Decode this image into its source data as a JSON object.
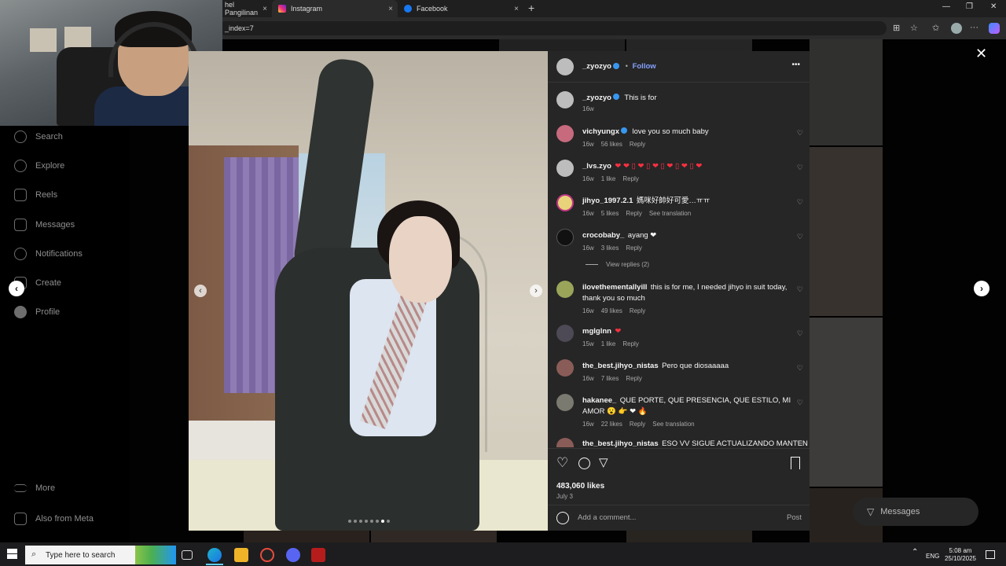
{
  "browser": {
    "tabs": [
      {
        "title": "hel Pangilinan"
      },
      {
        "title": "Instagram"
      },
      {
        "title": "Facebook"
      }
    ],
    "url": "_index=7",
    "new_tab": "+",
    "close": "×"
  },
  "sidebar": {
    "items": [
      {
        "label": "Search"
      },
      {
        "label": "Explore"
      },
      {
        "label": "Reels"
      },
      {
        "label": "Messages"
      },
      {
        "label": "Notifications"
      },
      {
        "label": "Create"
      },
      {
        "label": "Profile"
      }
    ],
    "more": "More",
    "also_from_meta": "Also from Meta"
  },
  "post": {
    "username": "_zyozyo",
    "follow": "Follow",
    "more": "•••",
    "caption": {
      "username": "_zyozyo",
      "text": "This is for",
      "time": "16w"
    },
    "comments": [
      {
        "username": "vichyungx",
        "verified": true,
        "text": "love you so much baby",
        "time": "16w",
        "likes": "56 likes",
        "reply": "Reply"
      },
      {
        "username": "_lvs.zyo",
        "text": "❤ ❤ ▯ ❤ ▯ ❤ ▯ ❤ ▯ ❤ ▯ ❤",
        "time": "16w",
        "likes": "1 like",
        "reply": "Reply"
      },
      {
        "username": "jihyo_1997.2.1",
        "text": "媽咪好帥好可愛…ㅠㅠ",
        "time": "16w",
        "likes": "5 likes",
        "reply": "Reply",
        "translate": "See translation"
      },
      {
        "username": "crocobaby_",
        "text": "ayang ❤",
        "time": "16w",
        "likes": "3 likes",
        "reply": "Reply"
      },
      {
        "username": "ilovethementallyill",
        "text": "this is for me, I needed jihyo in suit today, thank you so much",
        "time": "16w",
        "likes": "49 likes",
        "reply": "Reply"
      },
      {
        "username": "mglglnn",
        "text": "❤",
        "time": "15w",
        "likes": "1 like",
        "reply": "Reply"
      },
      {
        "username": "the_best.jihyo_nistas",
        "text": "Pero que diosaaaaa",
        "time": "16w",
        "likes": "7 likes",
        "reply": "Reply"
      },
      {
        "username": "hakanee_",
        "text": "QUE PORTE, QUE PRESENCIA, QUE ESTILO, MI AMOR 😮 👉 ❤ 🔥",
        "time": "16w",
        "likes": "22 likes",
        "reply": "Reply",
        "translate": "See translation"
      },
      {
        "username": "the_best.jihyo_nistas",
        "text": "ESO VV SIGUE ACTUALIZANDO MANTEN"
      }
    ],
    "view_replies": "View replies (2)",
    "likes": "483,060 likes",
    "date": "July 3",
    "add_comment_placeholder": "Add a comment...",
    "post_button": "Post"
  },
  "floating_messages": "Messages",
  "taskbar": {
    "search_placeholder": "Type here to search",
    "lang": "ENG",
    "time": "5:08 am",
    "date": "25/10/2025"
  },
  "colors": {
    "panel_bg": "#262626",
    "follow": "#85a1ff",
    "verified": "#3897f0",
    "heart": "#ff3040"
  },
  "icons": [
    "search-icon",
    "explore-icon",
    "reels-icon",
    "messages-icon",
    "heart-icon",
    "create-icon",
    "profile-icon",
    "menu-icon",
    "meta-icon",
    "comment-icon",
    "share-icon",
    "bookmark-icon",
    "emoji-icon",
    "close-icon"
  ]
}
